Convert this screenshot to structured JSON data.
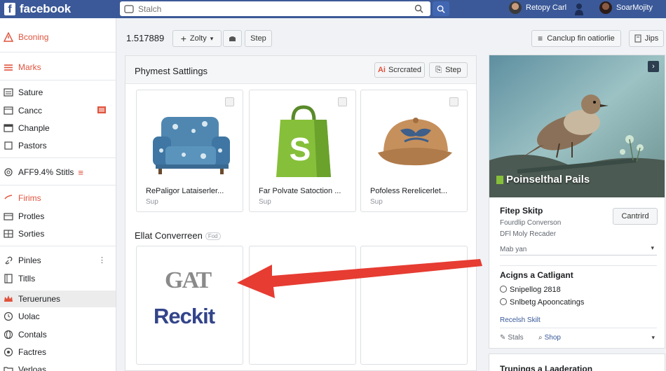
{
  "topbar": {
    "brand": "facebook",
    "search_placeholder": "Stalch",
    "user1": "Retopy Carl",
    "user2": "SoarMojity"
  },
  "sidebar": {
    "items": [
      {
        "label": "Bconing",
        "icon": "warning-icon"
      },
      {
        "label": "Marks",
        "icon": "menu-icon"
      },
      {
        "label": "Sature",
        "icon": "list-icon"
      },
      {
        "label": "Cancc",
        "icon": "document-icon"
      },
      {
        "label": "Chanple",
        "icon": "window-icon"
      },
      {
        "label": "Pastors",
        "icon": "square-icon"
      },
      {
        "label": "AFF9.4% Stitls",
        "icon": "at-icon"
      },
      {
        "label": "Firims",
        "icon": "check-icon"
      },
      {
        "label": "Protles",
        "icon": "shop-icon"
      },
      {
        "label": "Sorties",
        "icon": "grid-icon"
      },
      {
        "label": "Pinles",
        "icon": "link-icon"
      },
      {
        "label": "Titlls",
        "icon": "book-icon"
      },
      {
        "label": "Teruerunes",
        "icon": "crown-icon"
      },
      {
        "label": "Uolac",
        "icon": "clock-icon"
      },
      {
        "label": "Contals",
        "icon": "globe-icon"
      },
      {
        "label": "Factres",
        "icon": "gear-icon"
      },
      {
        "label": "Verloas",
        "icon": "folder-icon"
      }
    ]
  },
  "header": {
    "count": "1.517889",
    "zolty_label": "Zolty",
    "step_label": "Step",
    "cancel_label": "Canclup fin oatiorlie",
    "jips_label": "Jips"
  },
  "panel": {
    "title": "Phymest Sattlings",
    "scrcrated_label": "Scrcrated",
    "step_label": "Step",
    "section_title": "Ellat Converreen",
    "section_tag": "Fod",
    "cards": [
      {
        "title": "RePaligor Lataiserler...",
        "sub": "Sup"
      },
      {
        "title": "Far Polvate Satoction ...",
        "sub": "Sup"
      },
      {
        "title": "Pofoless Rerelicerlet...",
        "sub": "Sup"
      }
    ],
    "logo_top": "GAT",
    "logo_bottom": "Reckit"
  },
  "right": {
    "hero_caption": "Poinselthal Pails",
    "section1_title": "Fitep Skitp",
    "section1_line1": "Fourdlip Converson",
    "section1_line2": "DFl Moly Recader",
    "button_label": "Cantrird",
    "select_value": "Mab yan",
    "section2_title": "Acigns a Catligant",
    "item1": "Snipellog 2818",
    "item2": "Snlbetg Apooncatings",
    "link": "Recelsh Skilt",
    "stats_label": "Stals",
    "shop_label": "Shop",
    "bottom_title": "Trunings a Laaderation"
  },
  "colors": {
    "brand_blue": "#3b5998",
    "accent_red": "#e0533d",
    "link_blue": "#385898"
  }
}
